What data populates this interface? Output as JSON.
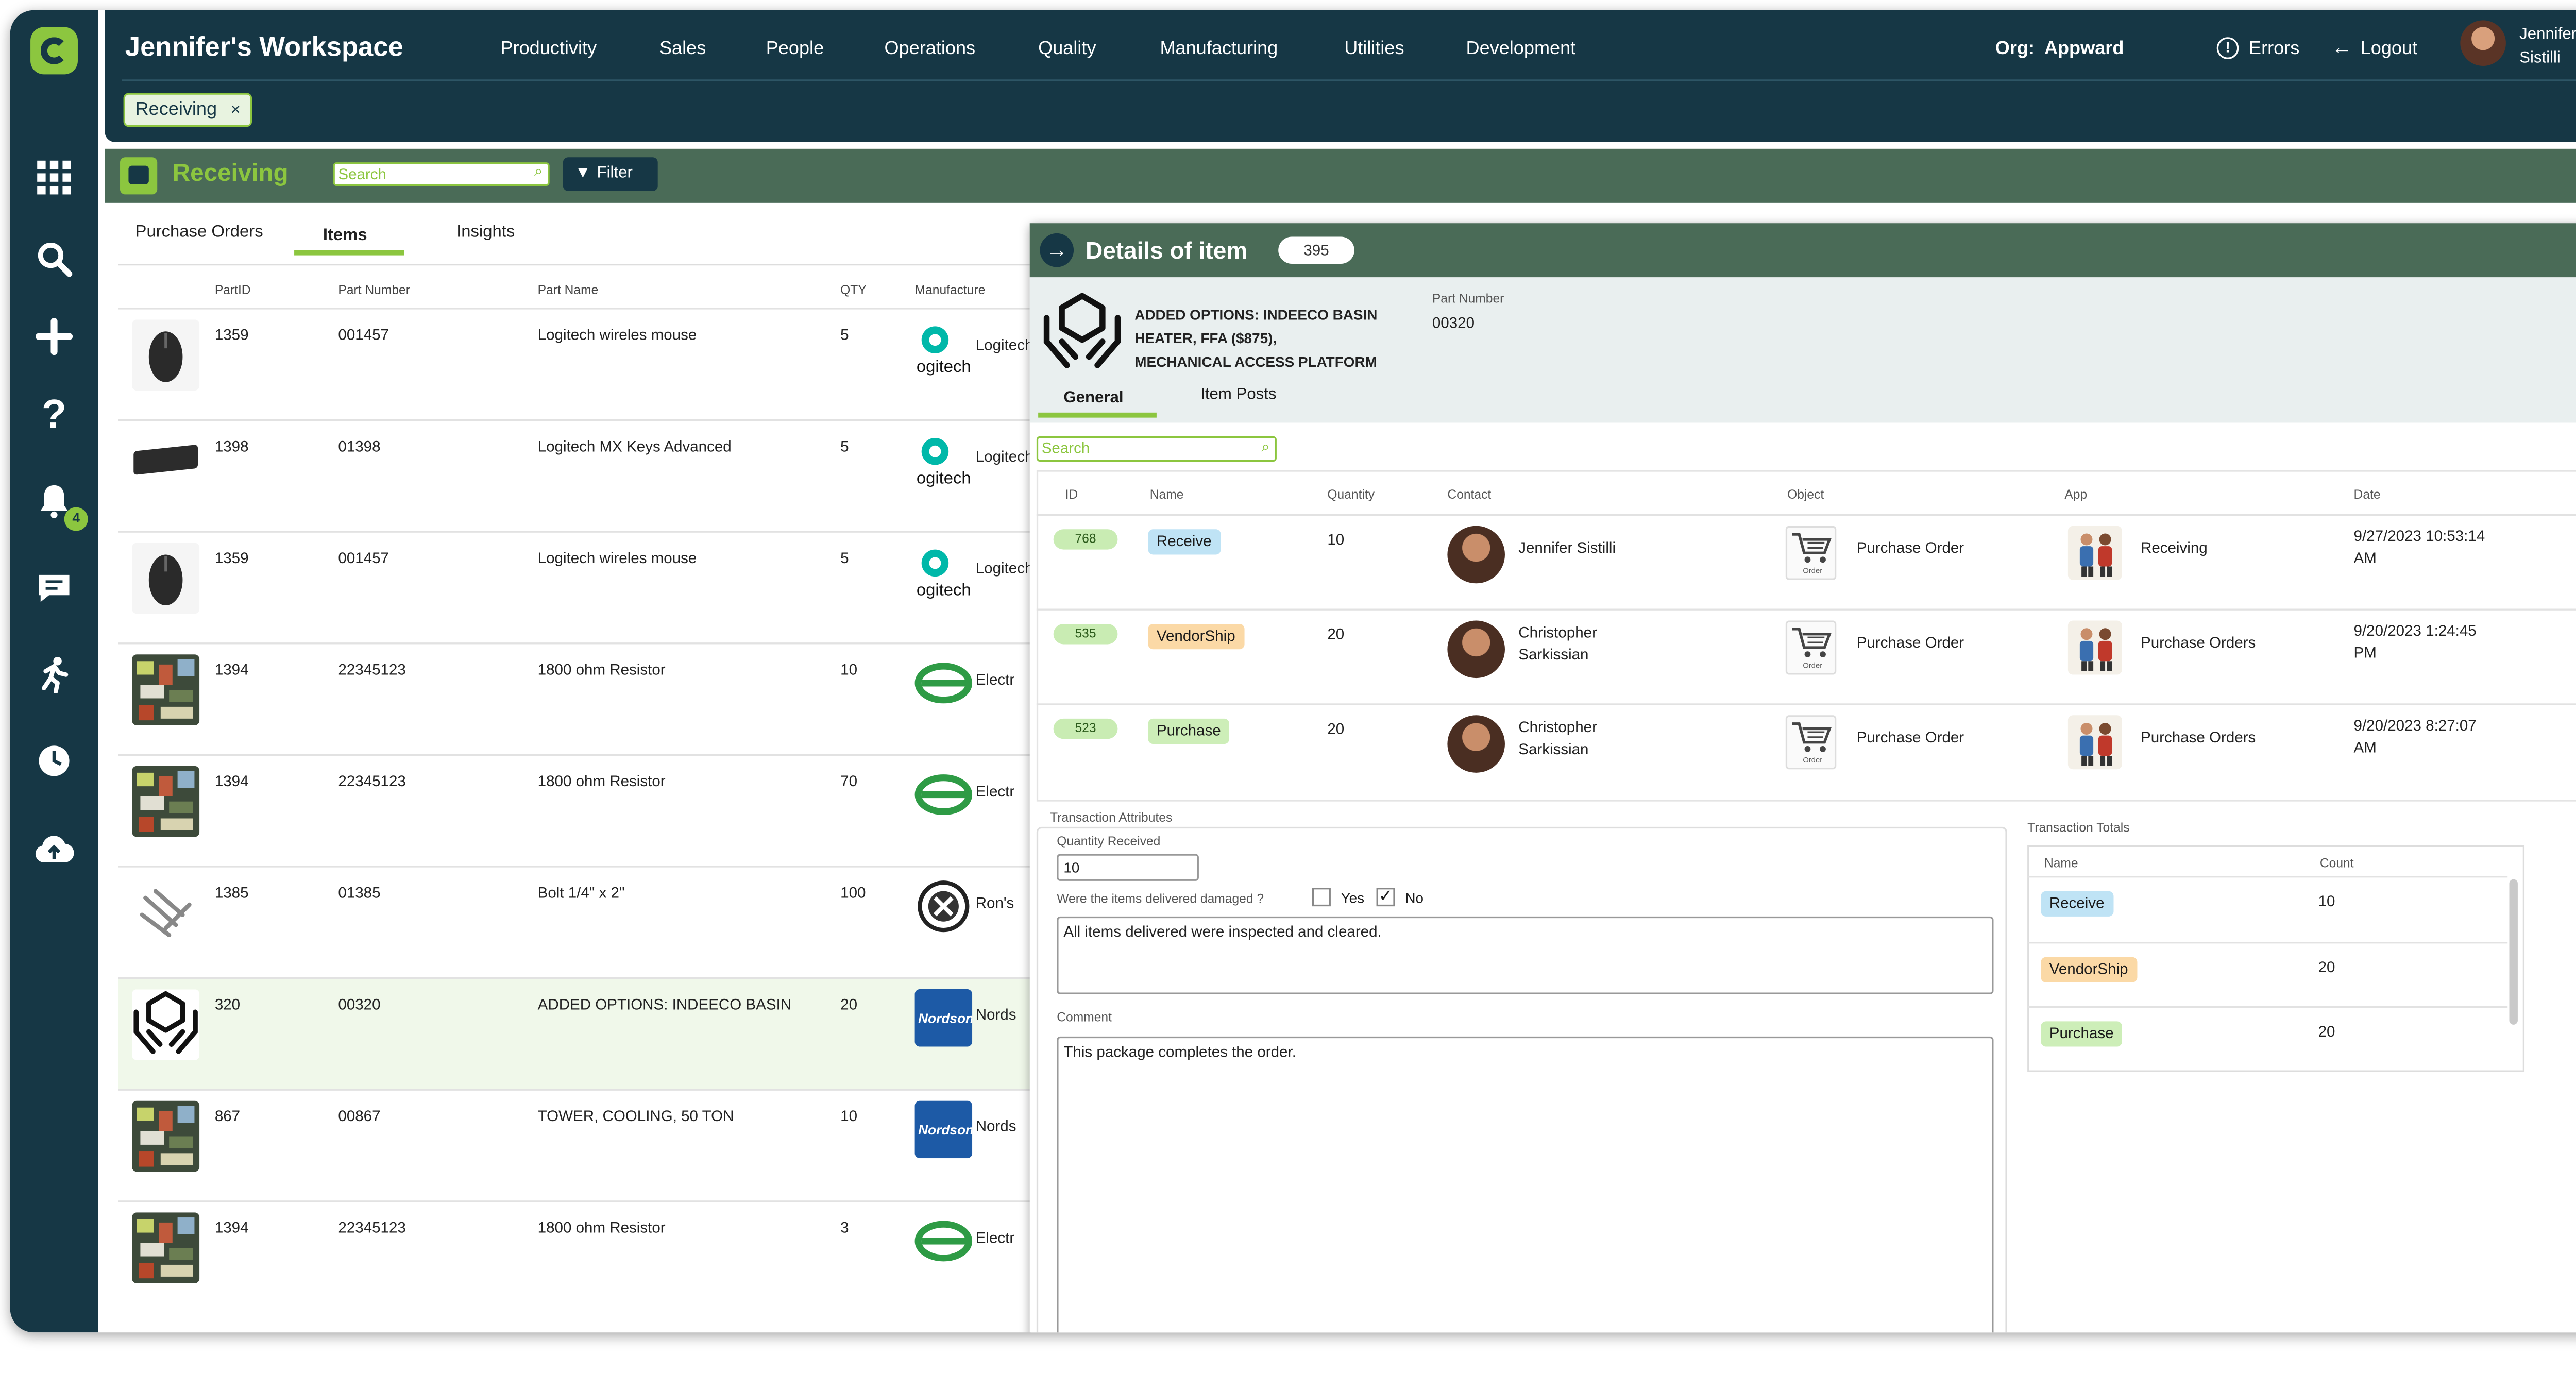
{
  "header": {
    "workspace_title": "Jennifer's Workspace",
    "nav": [
      "Productivity",
      "Sales",
      "People",
      "Operations",
      "Quality",
      "Manufacturing",
      "Utilities",
      "Development"
    ],
    "org_label": "Org:",
    "org_value": "Appward",
    "errors_label": "Errors",
    "logout_label": "Logout",
    "user_first": "Jennifer",
    "user_last": "Sistilli",
    "open_tab": "Receiving",
    "close_glyph": "×"
  },
  "sidebar": {
    "icons": [
      "apps-grid-icon",
      "search-icon",
      "add-icon",
      "help-icon",
      "bell-icon",
      "chat-icon",
      "activity-icon",
      "clock-icon",
      "upload-cloud-icon"
    ],
    "notification_count": "4"
  },
  "module": {
    "title": "Receiving",
    "search_placeholder": "Search",
    "filter_label": "Filter"
  },
  "left": {
    "tabs": [
      "Purchase Orders",
      "Items",
      "Insights"
    ],
    "active_tab": "Items",
    "columns": [
      "PartID",
      "Part Number",
      "Part Name",
      "QTY",
      "Manufacture"
    ],
    "rows": [
      {
        "part_id": "1359",
        "part_number": "001457",
        "part_name": "Logitech wireles mouse",
        "qty": "5",
        "manufacturer": "Logitech",
        "thumb": "mouse",
        "logo": "logitech"
      },
      {
        "part_id": "1398",
        "part_number": "01398",
        "part_name": "Logitech MX Keys Advanced",
        "qty": "5",
        "manufacturer": "Logitech",
        "thumb": "keyboard",
        "logo": "logitech"
      },
      {
        "part_id": "1359",
        "part_number": "001457",
        "part_name": "Logitech wireles mouse",
        "qty": "5",
        "manufacturer": "Logitech",
        "thumb": "mouse",
        "logo": "logitech"
      },
      {
        "part_id": "1394",
        "part_number": "22345123",
        "part_name": "1800 ohm Resistor",
        "qty": "10",
        "manufacturer": "Electr",
        "thumb": "circuit",
        "logo": "electro"
      },
      {
        "part_id": "1394",
        "part_number": "22345123",
        "part_name": "1800 ohm Resistor",
        "qty": "70",
        "manufacturer": "Electr",
        "thumb": "circuit",
        "logo": "electro"
      },
      {
        "part_id": "1385",
        "part_number": "01385",
        "part_name": "Bolt 1/4\" x 2\"",
        "qty": "100",
        "manufacturer": "Ron's",
        "thumb": "bolts",
        "logo": "rons"
      },
      {
        "part_id": "320",
        "part_number": "00320",
        "part_name": "ADDED OPTIONS: INDEECO BASIN",
        "qty": "20",
        "manufacturer": "Nords",
        "thumb": "hands",
        "logo": "nordson"
      },
      {
        "part_id": "867",
        "part_number": "00867",
        "part_name": "TOWER, COOLING, 50 TON",
        "qty": "10",
        "manufacturer": "Nords",
        "thumb": "tower",
        "logo": "nordson"
      },
      {
        "part_id": "1394",
        "part_number": "22345123",
        "part_name": "1800 ohm Resistor",
        "qty": "3",
        "manufacturer": "Electr",
        "thumb": "circuit",
        "logo": "electro"
      }
    ]
  },
  "details": {
    "title": "Details of item",
    "count": "395",
    "item_name_lines": [
      "ADDED OPTIONS: INDEECO BASIN",
      "HEATER, FFA ($875),",
      "MECHANICAL ACCESS PLATFORM"
    ],
    "part_number_label": "Part Number",
    "part_number": "00320",
    "tabs": [
      "General",
      "Item Posts"
    ],
    "search_placeholder": "Search",
    "columns": [
      "ID",
      "Name",
      "Quantity",
      "Contact",
      "Object",
      "App",
      "Date"
    ],
    "rows": [
      {
        "id": "768",
        "name": "Receive",
        "name_color": "#bfe3f5",
        "quantity": "10",
        "contact": [
          "Jennifer Sistilli"
        ],
        "object": "Purchase Order",
        "app": "Receiving",
        "date": [
          "9/27/2023 10:53:14",
          "AM"
        ]
      },
      {
        "id": "535",
        "name": "VendorShip",
        "name_color": "#fbd9a6",
        "quantity": "20",
        "contact": [
          "Christopher",
          "Sarkissian"
        ],
        "object": "Purchase Order",
        "app": "Purchase Orders",
        "date": [
          "9/20/2023 1:24:45",
          "PM"
        ]
      },
      {
        "id": "523",
        "name": "Purchase",
        "name_color": "#cdeeb8",
        "quantity": "20",
        "contact": [
          "Christopher",
          "Sarkissian"
        ],
        "object": "Purchase Order",
        "app": "Purchase Orders",
        "date": [
          "9/20/2023 8:27:07",
          "AM"
        ]
      }
    ],
    "cart_caption": "Order",
    "attributes": {
      "legend": "Transaction Attributes",
      "qty_label": "Quantity Received",
      "qty_value": "10",
      "damaged_question": "Were the items delivered damaged ?",
      "yes_label": "Yes",
      "no_label": "No",
      "yes_checked": false,
      "no_checked": true,
      "notes": "All items delivered were inspected and cleared.",
      "comment_label": "Comment",
      "comment": "This package completes the order.",
      "check_glyph": "✓"
    },
    "totals": {
      "legend": "Transaction Totals",
      "columns": [
        "Name",
        "Count"
      ],
      "rows": [
        {
          "name": "Receive",
          "color": "#bfe3f5",
          "count": "10"
        },
        {
          "name": "VendorShip",
          "color": "#fbd9a6",
          "count": "20"
        },
        {
          "name": "Purchase",
          "color": "#cdeeb8",
          "count": "20"
        }
      ]
    }
  }
}
